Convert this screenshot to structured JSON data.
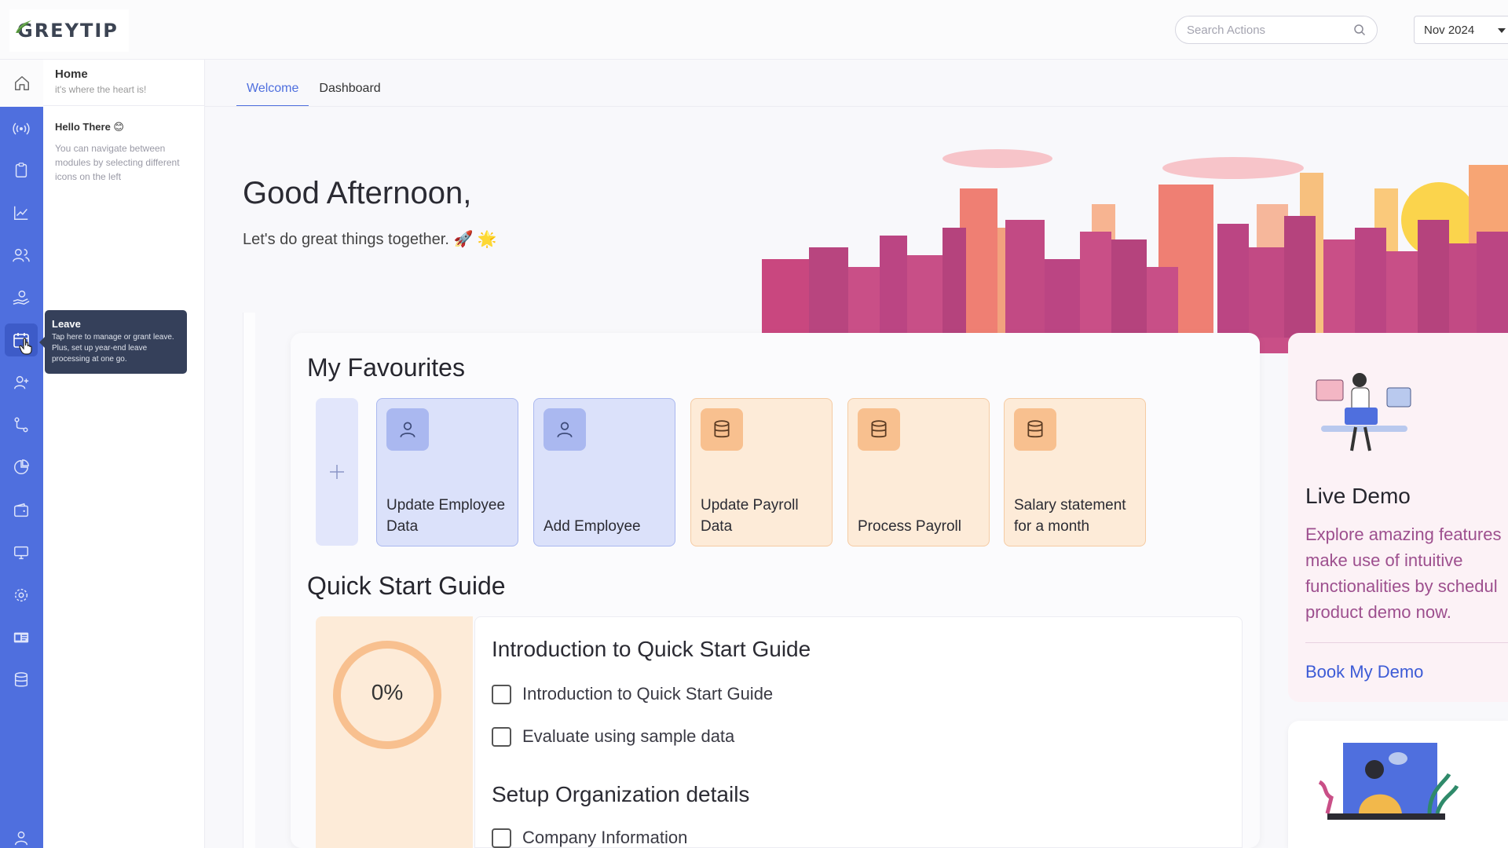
{
  "app": {
    "logo_text": "GREYTIP"
  },
  "header": {
    "search_placeholder": "Search Actions",
    "month_selected": "Nov 2024"
  },
  "rail": {
    "accent_color": "#4f6fde",
    "icons": [
      "home-icon",
      "broadcast-icon",
      "clipboard-icon",
      "chart-line-icon",
      "users-icon",
      "hand-coin-icon",
      "calendar-icon",
      "user-plus-icon",
      "route-icon",
      "pie-chart-icon",
      "wallet-icon",
      "monitor-icon",
      "settings-icon",
      "id-card-icon",
      "database-icon",
      "user-icon"
    ],
    "active": "calendar-icon"
  },
  "subpanel": {
    "home_title": "Home",
    "home_subtitle": "it's where the heart is!",
    "hello_title": "Hello There 😊",
    "hello_text": "You can navigate between modules by selecting different icons on the left"
  },
  "tooltip": {
    "title": "Leave",
    "text": "Tap here to manage or grant leave. Plus, set up year-end leave processing at one go."
  },
  "tabs": [
    {
      "label": "Welcome",
      "active": true
    },
    {
      "label": "Dashboard",
      "active": false
    }
  ],
  "greeting": {
    "title": "Good Afternoon,",
    "subtitle": "Let's do great things together. 🚀 🌟"
  },
  "favourites": {
    "title": "My Favourites",
    "items": [
      {
        "label": "Update Employee Data",
        "icon": "user-icon",
        "color": "blue"
      },
      {
        "label": "Add Employee",
        "icon": "user-icon",
        "color": "blue"
      },
      {
        "label": "Update Payroll Data",
        "icon": "database-icon",
        "color": "orange"
      },
      {
        "label": "Process Payroll",
        "icon": "database-icon",
        "color": "orange"
      },
      {
        "label": "Salary statement for a month",
        "icon": "database-icon",
        "color": "orange"
      }
    ]
  },
  "quick_start": {
    "title": "Quick Start Guide",
    "progress": "0%",
    "sections": [
      {
        "title": "Introduction to Quick Start Guide",
        "items": [
          "Introduction to Quick Start Guide",
          "Evaluate using sample data"
        ]
      },
      {
        "title": "Setup Organization details",
        "items": [
          "Company Information"
        ]
      }
    ]
  },
  "live_demo": {
    "title": "Live Demo",
    "text": "Explore amazing features\nmake use of intuitive\nfunctionalities by schedul\nproduct demo now.",
    "link": "Book My Demo"
  }
}
